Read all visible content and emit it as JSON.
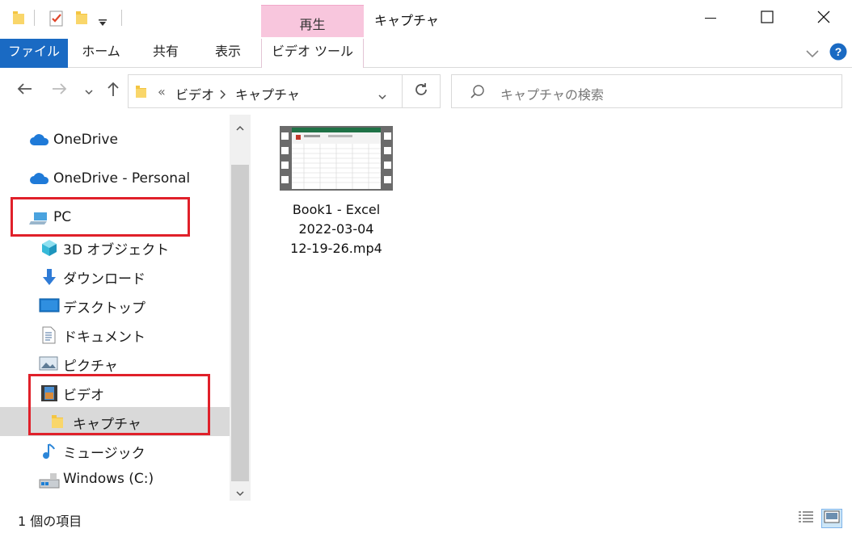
{
  "window": {
    "title": "キャプチャ",
    "context_tab_group": "再生"
  },
  "ribbon": {
    "tabs": [
      "ファイル",
      "ホーム",
      "共有",
      "表示",
      "ビデオ ツール"
    ]
  },
  "address": {
    "separator": "«",
    "crumbs": [
      "ビデオ",
      "キャプチャ"
    ],
    "search_placeholder": "キャプチャの検索"
  },
  "nav": {
    "items": [
      {
        "label": "OneDrive",
        "icon": "cloud-icon"
      },
      {
        "label": "OneDrive - Personal",
        "icon": "cloud-icon"
      },
      {
        "label": "PC",
        "icon": "computer-icon"
      },
      {
        "label": "3D オブジェクト",
        "icon": "cube-icon"
      },
      {
        "label": "ダウンロード",
        "icon": "download-arrow-icon"
      },
      {
        "label": "デスクトップ",
        "icon": "desktop-icon"
      },
      {
        "label": "ドキュメント",
        "icon": "document-icon"
      },
      {
        "label": "ピクチャ",
        "icon": "picture-icon"
      },
      {
        "label": "ビデオ",
        "icon": "video-film-icon"
      },
      {
        "label": "キャプチャ",
        "icon": "folder-icon",
        "selected": true
      },
      {
        "label": "ミュージック",
        "icon": "music-note-icon"
      },
      {
        "label": "Windows (C:)",
        "icon": "drive-icon"
      }
    ]
  },
  "files": [
    {
      "name_lines": [
        "Book1 - Excel",
        "2022-03-04",
        "12-19-26.mp4"
      ],
      "icon": "video-thumbnail-icon"
    }
  ],
  "status": {
    "item_count": "1 個の項目"
  },
  "colors": {
    "accent": "#1a6ac3",
    "context_tab": "#f8c6dd",
    "highlight_box": "#e0202a",
    "selected_row": "#d9d9d9"
  }
}
